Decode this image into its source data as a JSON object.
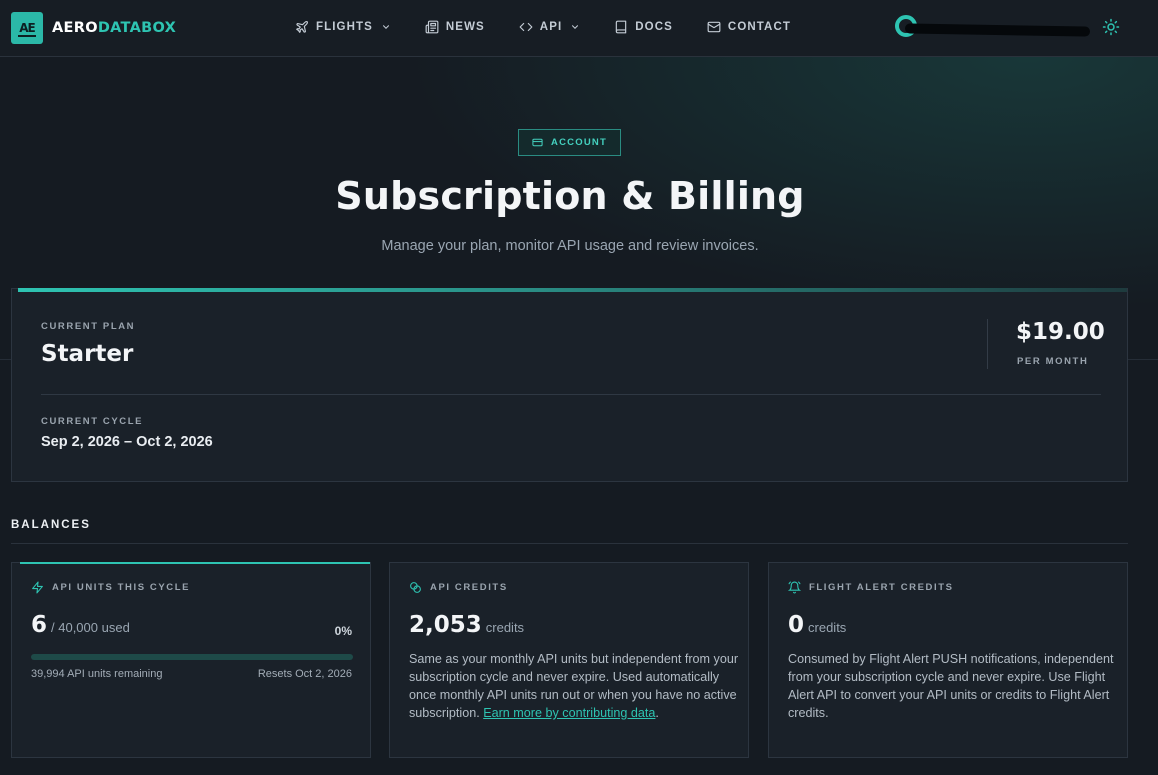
{
  "brand": {
    "mark": "AE",
    "name_a": "AERO",
    "name_b": "DATABOX"
  },
  "nav": {
    "items": [
      {
        "label": "FLIGHTS",
        "icon": "plane-icon",
        "dropdown": true
      },
      {
        "label": "NEWS",
        "icon": "newspaper-icon",
        "dropdown": false
      },
      {
        "label": "API",
        "icon": "code-icon",
        "dropdown": true
      },
      {
        "label": "DOCS",
        "icon": "book-icon",
        "dropdown": false
      },
      {
        "label": "CONTACT",
        "icon": "mail-icon",
        "dropdown": false
      }
    ]
  },
  "hero": {
    "badge": "ACCOUNT",
    "title": "Subscription & Billing",
    "subtitle": "Manage your plan, monitor API usage and review invoices."
  },
  "plan": {
    "label": "CURRENT PLAN",
    "name": "Starter",
    "price": "$19.00",
    "price_unit": "PER MONTH",
    "cycle_label": "CURRENT CYCLE",
    "cycle_value": "Sep 2, 2026 – Oct 2, 2026"
  },
  "balances": {
    "title": "BALANCES",
    "units": {
      "label": "API UNITS THIS CYCLE",
      "used": "6",
      "of_total": "/ 40,000 used",
      "percent": "0%",
      "progress_fraction": 0.00015,
      "remaining": "39,994 API units remaining",
      "resets": "Resets Oct 2, 2026"
    },
    "credits": {
      "label": "API CREDITS",
      "value": "2,053",
      "unit": "credits",
      "desc": "Same as your monthly API units but independent from your subscription cycle and never expire. Used automatically once monthly API units run out or when you have no active subscription.",
      "link": "Earn more by contributing data",
      "after_link": "."
    },
    "alerts": {
      "label": "FLIGHT ALERT CREDITS",
      "value": "0",
      "unit": "credits",
      "desc": "Consumed by Flight Alert PUSH notifications, independent from your subscription cycle and never expire. Use Flight Alert API to convert your API units or credits to Flight Alert credits."
    }
  },
  "colors": {
    "accent": "#2ec4b2",
    "background": "#151b22",
    "card": "#1a2129"
  }
}
